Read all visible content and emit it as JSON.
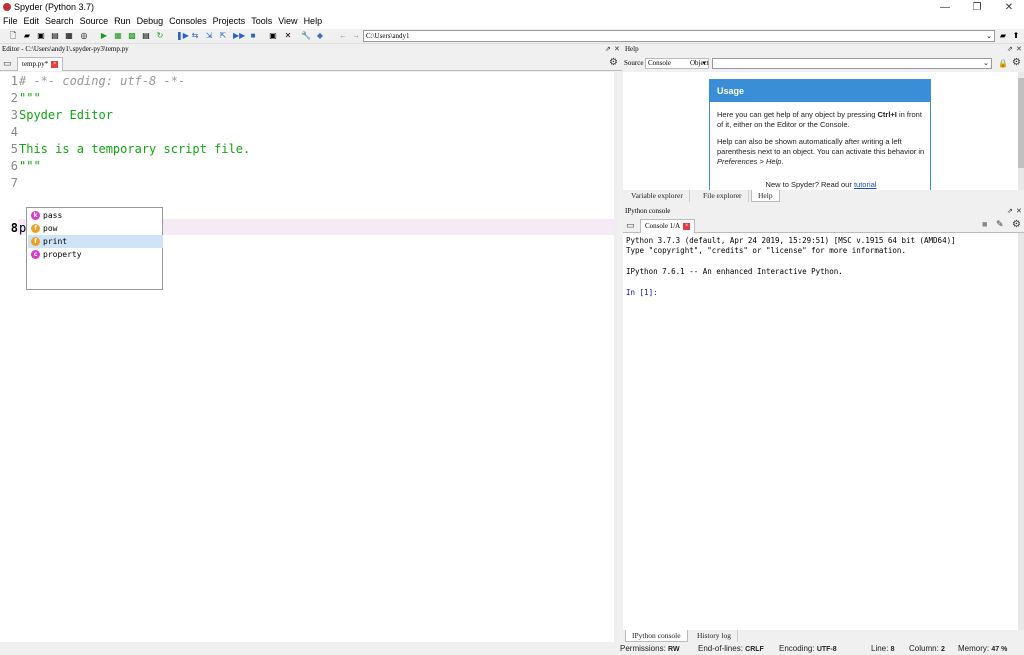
{
  "window": {
    "title": "Spyder (Python 3.7)",
    "minimize": "—",
    "restore": "❐",
    "close": "✕"
  },
  "menu": [
    "File",
    "Edit",
    "Search",
    "Source",
    "Run",
    "Debug",
    "Consoles",
    "Projects",
    "Tools",
    "View",
    "Help"
  ],
  "toolbar": {
    "path": "C:\\Users\\andy1"
  },
  "editor": {
    "pane_title": "Editor - C:\\Users\\andy1\\.spyder-py3\\temp.py",
    "tab_label": "temp.py*",
    "lines": [
      {
        "n": "1",
        "text": "# -*- coding: utf-8 -*-"
      },
      {
        "n": "2",
        "text": "\"\"\""
      },
      {
        "n": "3",
        "text": "Spyder Editor"
      },
      {
        "n": "4",
        "text": ""
      },
      {
        "n": "5",
        "text": "This is a temporary script file."
      },
      {
        "n": "6",
        "text": "\"\"\""
      },
      {
        "n": "7",
        "text": ""
      },
      {
        "n": "8",
        "text": "p"
      }
    ],
    "completions": [
      {
        "label": "pass",
        "color": "#d63cc8"
      },
      {
        "label": "pow",
        "color": "#f0a020"
      },
      {
        "label": "print",
        "color": "#f0a020"
      },
      {
        "label": "property",
        "color": "#d63cc8"
      }
    ]
  },
  "help": {
    "pane_title": "Help",
    "source_label": "Source",
    "source_value": "Console",
    "object_label": "Object",
    "usage_title": "Usage",
    "usage_p1_a": "Here you can get help of any object by pressing ",
    "usage_p1_key": "Ctrl+I",
    "usage_p1_b": " in front of it, either on the Editor or the Console.",
    "usage_p2_a": "Help can also be shown automatically after writing a left parenthesis next to an object. You can activate this behavior in ",
    "usage_p2_em": "Preferences > Help",
    "usage_p2_b": ".",
    "usage_foot": "New to Spyder? Read our ",
    "usage_link": "tutorial",
    "tabs": [
      "Variable explorer",
      "File explorer",
      "Help"
    ]
  },
  "console": {
    "pane_title": "IPython console",
    "tab_label": "Console 1/A",
    "lines": [
      "Python 3.7.3 (default, Apr 24 2019, 15:29:51) [MSC v.1915 64 bit (AMD64)]",
      "Type \"copyright\", \"credits\" or \"license\" for more information.",
      "",
      "IPython 7.6.1 -- An enhanced Interactive Python.",
      "",
      "In [1]:"
    ],
    "tabs": [
      "IPython console",
      "History log"
    ]
  },
  "status": {
    "permissions_label": "Permissions:",
    "permissions": "RW",
    "eol_label": "End-of-lines:",
    "eol": "CRLF",
    "encoding_label": "Encoding:",
    "encoding": "UTF-8",
    "line_label": "Line:",
    "line": "8",
    "column_label": "Column:",
    "column": "2",
    "memory_label": "Memory:",
    "memory": "47 %"
  }
}
